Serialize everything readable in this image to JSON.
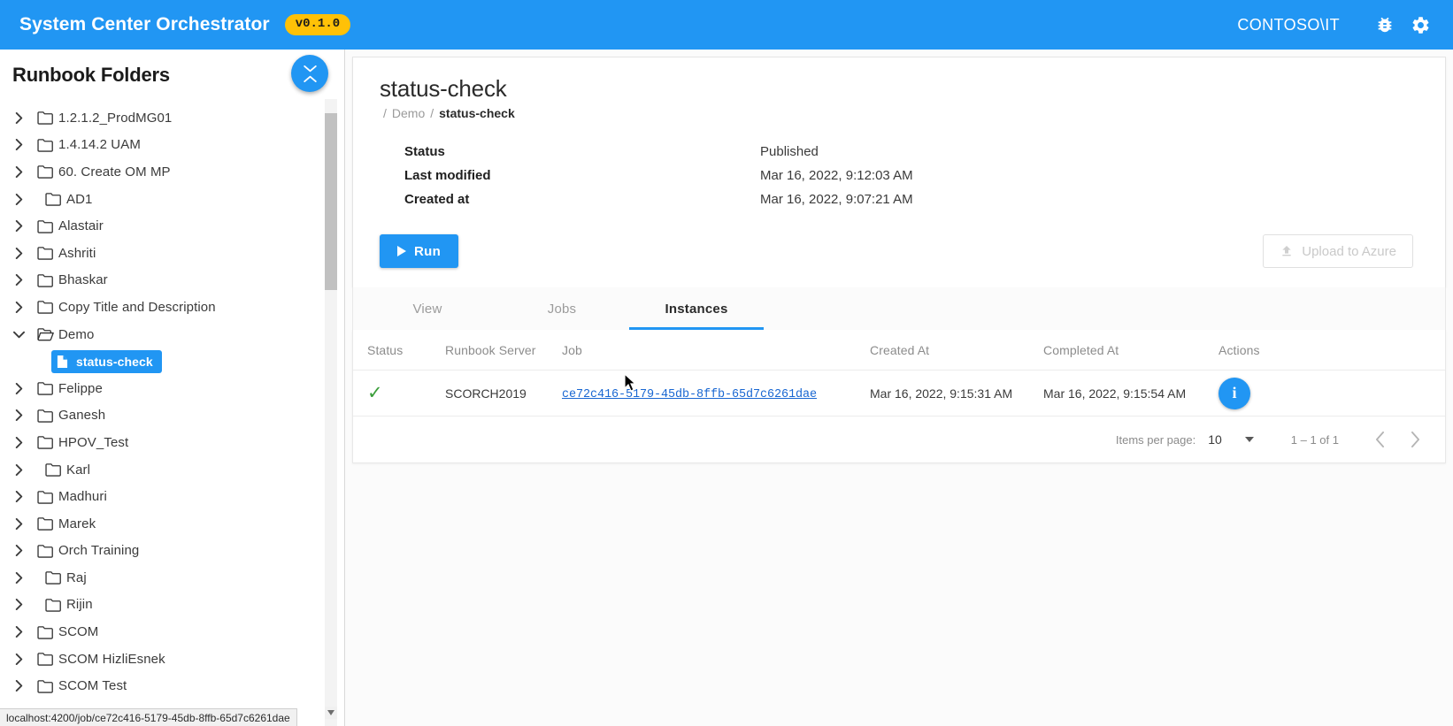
{
  "topbar": {
    "brand": "System Center Orchestrator",
    "version": "v0.1.0",
    "user": "CONTOSO\\IT",
    "bug_icon": "bug-icon",
    "settings_icon": "gear-icon",
    "bg_color": "#2196f3",
    "badge_color": "#ffc107"
  },
  "sidebar": {
    "title": "Runbook Folders",
    "collapse_toggle": "expand-collapse-toggle",
    "items": [
      {
        "label": "1.2.1.2_ProdMG01",
        "type": "folder",
        "expanded": false,
        "indent": 0
      },
      {
        "label": "1.4.14.2 UAM",
        "type": "folder",
        "expanded": false,
        "indent": 0
      },
      {
        "label": "60. Create OM MP",
        "type": "folder",
        "expanded": false,
        "indent": 0
      },
      {
        "label": "AD1",
        "type": "folder",
        "expanded": false,
        "indent": 1
      },
      {
        "label": "Alastair",
        "type": "folder",
        "expanded": false,
        "indent": 0
      },
      {
        "label": "Ashriti",
        "type": "folder",
        "expanded": false,
        "indent": 0
      },
      {
        "label": "Bhaskar",
        "type": "folder",
        "expanded": false,
        "indent": 0
      },
      {
        "label": "Copy Title and Description",
        "type": "folder",
        "expanded": false,
        "indent": 0
      },
      {
        "label": "Demo",
        "type": "folder",
        "expanded": true,
        "indent": 0
      },
      {
        "label": "status-check",
        "type": "runbook",
        "selected": true,
        "indent": 2
      },
      {
        "label": "Felippe",
        "type": "folder",
        "expanded": false,
        "indent": 0
      },
      {
        "label": "Ganesh",
        "type": "folder",
        "expanded": false,
        "indent": 0
      },
      {
        "label": "HPOV_Test",
        "type": "folder",
        "expanded": false,
        "indent": 0
      },
      {
        "label": "Karl",
        "type": "folder",
        "expanded": false,
        "indent": 1
      },
      {
        "label": "Madhuri",
        "type": "folder",
        "expanded": false,
        "indent": 0
      },
      {
        "label": "Marek",
        "type": "folder",
        "expanded": false,
        "indent": 0
      },
      {
        "label": "Orch Training",
        "type": "folder",
        "expanded": false,
        "indent": 0
      },
      {
        "label": "Raj",
        "type": "folder",
        "expanded": false,
        "indent": 1
      },
      {
        "label": "Rijin",
        "type": "folder",
        "expanded": false,
        "indent": 1
      },
      {
        "label": "SCOM",
        "type": "folder",
        "expanded": false,
        "indent": 0
      },
      {
        "label": "SCOM HizliEsnek",
        "type": "folder",
        "expanded": false,
        "indent": 0
      },
      {
        "label": "SCOM Test",
        "type": "folder",
        "expanded": false,
        "indent": 0
      }
    ]
  },
  "main": {
    "title": "status-check",
    "breadcrumb": {
      "root": "/",
      "parent": "Demo",
      "sep": "/",
      "current": "status-check"
    },
    "meta": [
      {
        "key": "Status",
        "value": "Published"
      },
      {
        "key": "Last modified",
        "value": "Mar 16, 2022, 9:12:03 AM"
      },
      {
        "key": "Created at",
        "value": "Mar 16, 2022, 9:07:21 AM"
      }
    ],
    "run_button": "Run",
    "upload_button": "Upload to Azure",
    "tabs": [
      {
        "label": "View",
        "active": false
      },
      {
        "label": "Jobs",
        "active": false
      },
      {
        "label": "Instances",
        "active": true
      }
    ],
    "table": {
      "columns": [
        "Status",
        "Runbook Server",
        "Job",
        "Created At",
        "Completed At",
        "Actions"
      ],
      "rows": [
        {
          "status": "✓",
          "server": "SCORCH2019",
          "job": "ce72c416-5179-45db-8ffb-65d7c6261dae",
          "created_at": "Mar 16, 2022, 9:15:31 AM",
          "completed_at": "Mar 16, 2022, 9:15:54 AM",
          "action": "info-button"
        }
      ]
    },
    "paginator": {
      "items_per_page_label": "Items per page:",
      "items_per_page_value": "10",
      "range": "1 – 1 of 1",
      "prev": "previous-page",
      "next": "next-page"
    }
  },
  "statusbar": {
    "url": "localhost:4200/job/ce72c416-5179-45db-8ffb-65d7c6261dae"
  }
}
